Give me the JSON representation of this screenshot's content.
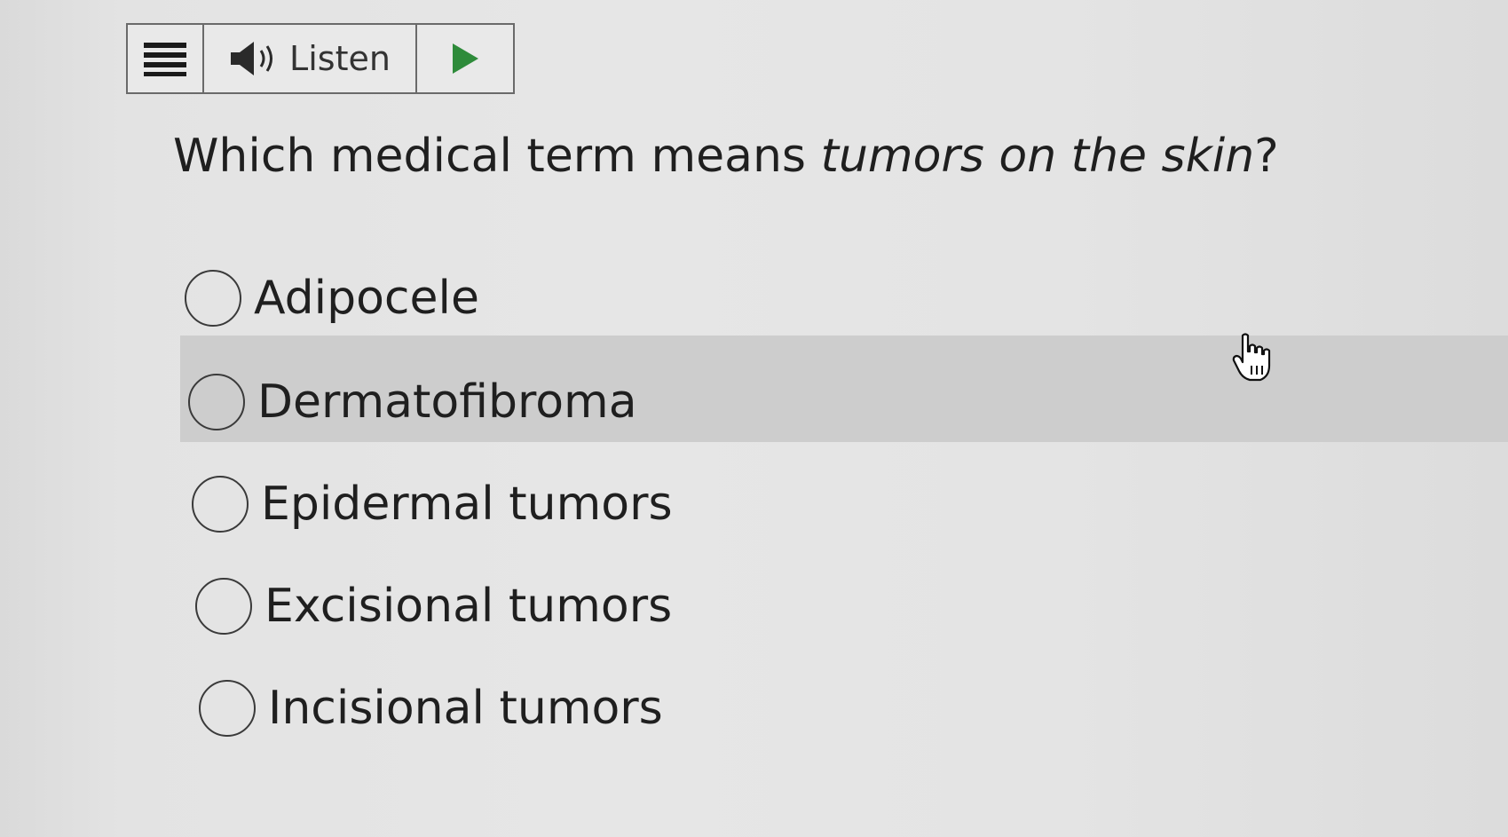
{
  "toolbar": {
    "menu_icon": "hamburger-menu-icon",
    "speaker_icon": "speaker-icon",
    "listen_label": "Listen",
    "play_icon": "play-icon",
    "accent_color": "#2e8b3a"
  },
  "question": {
    "prefix": "Which medical term means ",
    "emphasis": "tumors on the skin",
    "suffix": "?"
  },
  "options": [
    {
      "label": "Adipocele",
      "selected": false
    },
    {
      "label": "Dermatofibroma",
      "selected": false,
      "hovered": true
    },
    {
      "label": "Epidermal tumors",
      "selected": false
    },
    {
      "label": "Excisional tumors",
      "selected": false
    },
    {
      "label": "Incisional tumors",
      "selected": false
    }
  ],
  "cursor_icon": "hand-pointer-icon"
}
